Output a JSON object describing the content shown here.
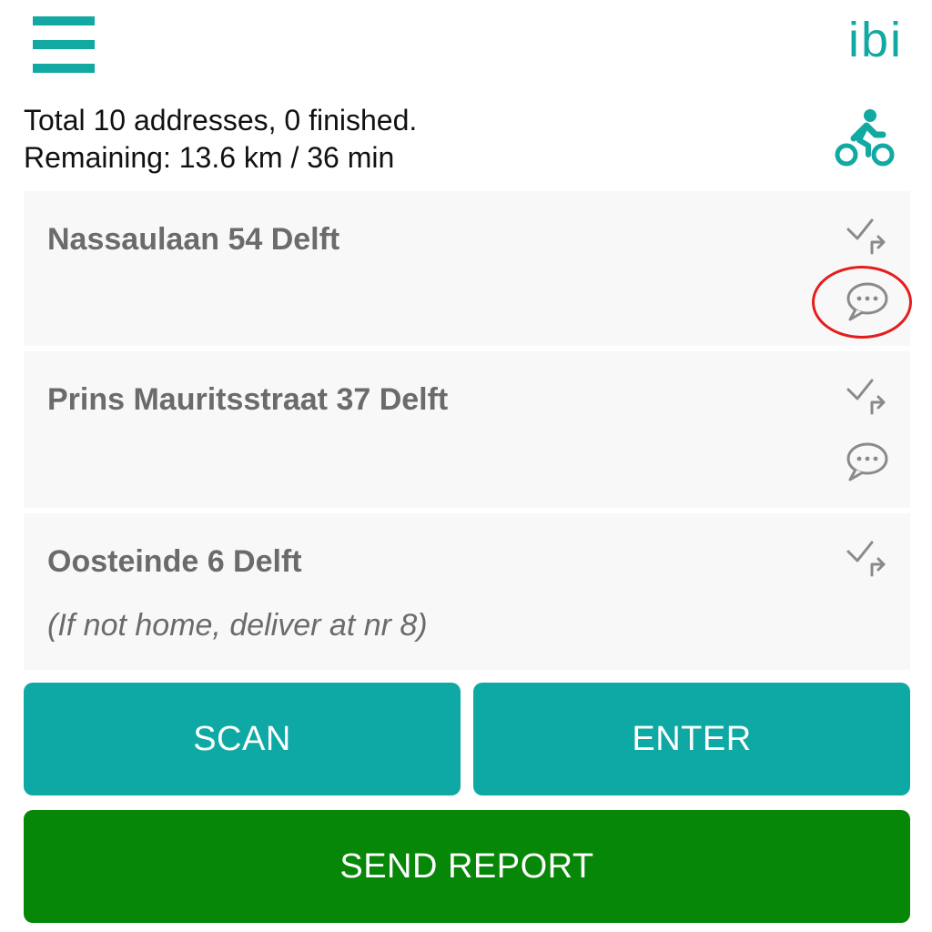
{
  "header": {
    "logo_text": "ibi",
    "menu_icon": "hamburger-menu-icon"
  },
  "summary": {
    "line1": "Total 10 addresses, 0 finished.",
    "line2": "Remaining: 13.6 km / 36 min",
    "mode_icon": "bicycle-icon"
  },
  "addresses": [
    {
      "address": "Nassaulaan 54 Delft",
      "note": "",
      "icons": [
        "check-forward-icon",
        "comment-icon"
      ]
    },
    {
      "address": "Prins Mauritsstraat 37 Delft",
      "note": "",
      "icons": [
        "check-forward-icon",
        "comment-icon"
      ]
    },
    {
      "address": "Oosteinde 6 Delft",
      "note": "(If not home, deliver at nr 8)",
      "icons": [
        "check-forward-icon"
      ]
    }
  ],
  "buttons": {
    "scan": "SCAN",
    "enter": "ENTER",
    "send_report": "SEND REPORT"
  },
  "colors": {
    "accent": "#12a9a3",
    "report_button": "#078707",
    "highlight": "#e41d1d",
    "icon_gray": "#8a8a8a",
    "item_background": "#f8f8f8"
  }
}
